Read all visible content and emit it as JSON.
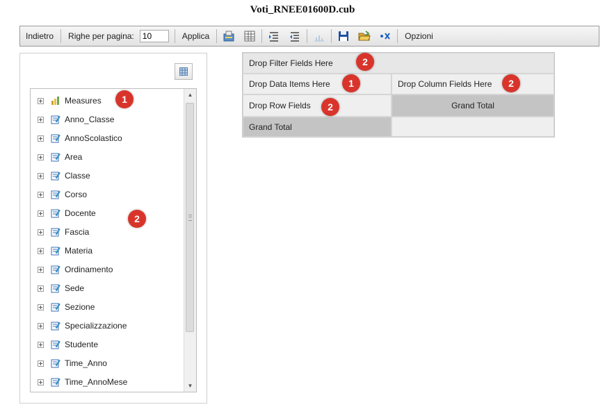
{
  "window": {
    "title": "Voti_RNEE01600D.cub"
  },
  "toolbar": {
    "back_label": "Indietro",
    "rows_per_page_label": "Righe per pagina:",
    "rows_per_page_value": "10",
    "apply_label": "Applica",
    "options_label": "Opzioni",
    "icons": [
      "export-icon",
      "table-icon",
      "indent-rows-icon",
      "indent-columns-icon",
      "chart-icon",
      "save-icon",
      "open-folder-icon",
      "clear-icon"
    ]
  },
  "field_list": {
    "items": [
      {
        "label": "Measures",
        "icon": "measures-icon"
      },
      {
        "label": "Anno_Classe",
        "icon": "dimension-icon"
      },
      {
        "label": "AnnoScolastico",
        "icon": "dimension-icon"
      },
      {
        "label": "Area",
        "icon": "dimension-icon"
      },
      {
        "label": "Classe",
        "icon": "dimension-icon"
      },
      {
        "label": "Corso",
        "icon": "dimension-icon"
      },
      {
        "label": "Docente",
        "icon": "dimension-icon"
      },
      {
        "label": "Fascia",
        "icon": "dimension-icon"
      },
      {
        "label": "Materia",
        "icon": "dimension-icon"
      },
      {
        "label": "Ordinamento",
        "icon": "dimension-icon"
      },
      {
        "label": "Sede",
        "icon": "dimension-icon"
      },
      {
        "label": "Sezione",
        "icon": "dimension-icon"
      },
      {
        "label": "Specializzazione",
        "icon": "dimension-icon"
      },
      {
        "label": "Studente",
        "icon": "dimension-icon"
      },
      {
        "label": "Time_Anno",
        "icon": "dimension-icon"
      },
      {
        "label": "Time_AnnoMese",
        "icon": "dimension-icon"
      }
    ]
  },
  "pivot": {
    "filter_drop": "Drop Filter Fields Here",
    "data_drop": "Drop Data Items Here",
    "column_drop": "Drop Column Fields Here",
    "row_drop": "Drop Row Fields",
    "grand_total_col": "Grand Total",
    "grand_total_row": "Grand Total"
  },
  "badges": {
    "measures": "1",
    "fields": "2",
    "filter": "2",
    "data": "1",
    "column": "2",
    "row": "2"
  },
  "colors": {
    "badge": "#d9342b",
    "header_gray": "#c4c4c4",
    "cell_gray": "#efefef"
  }
}
